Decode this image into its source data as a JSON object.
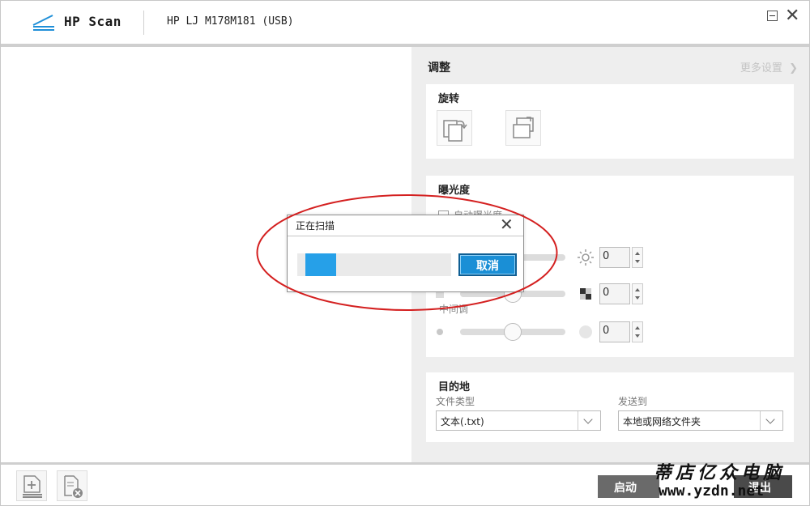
{
  "app": {
    "name": "HP Scan",
    "device": "HP LJ M178M181 (USB)"
  },
  "panel": {
    "title": "调整",
    "more_settings": "更多设置"
  },
  "rotate": {
    "title": "旋转"
  },
  "exposure": {
    "title": "曝光度",
    "auto_exposure_label": "自动曝光度",
    "brightness_value": "0",
    "contrast_value": "0",
    "midtone_label": "中间调",
    "midtone_value": "0"
  },
  "destination": {
    "title": "目的地",
    "file_type_label": "文件类型",
    "file_type_value": "文本(.txt)",
    "send_to_label": "发送到",
    "send_to_value": "本地或网络文件夹"
  },
  "bottom": {
    "start_label": "启动",
    "finish_label": "退出"
  },
  "dialog": {
    "title": "正在扫描",
    "cancel_label": "取消",
    "progress_fraction": 0.2
  },
  "watermark": {
    "text_cn": "蒂店亿众电脑",
    "url": "www.yzdn.net"
  },
  "colors": {
    "accent": "#26a0e8",
    "annotation": "#d42020",
    "panel_bg": "#eeeeee"
  }
}
